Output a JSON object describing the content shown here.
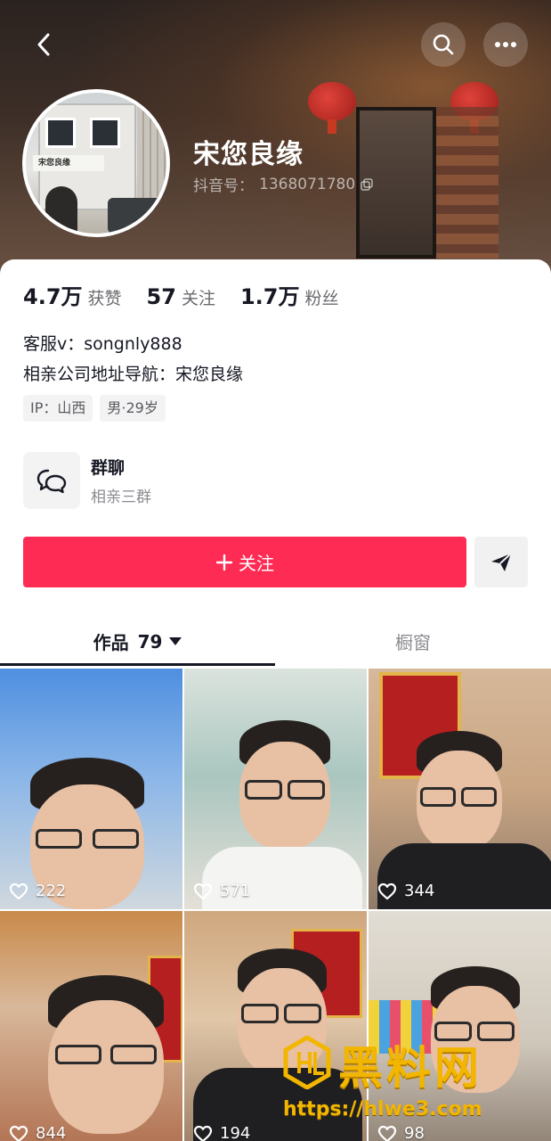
{
  "profile": {
    "display_name": "宋您良缘",
    "douyin_id_label": "抖音号：",
    "douyin_id": "1368071780",
    "avatar_sign_text": "宋您良缘"
  },
  "stats": [
    {
      "value": "4.7万",
      "label": "获赞"
    },
    {
      "value": "57",
      "label": "关注"
    },
    {
      "value": "1.7万",
      "label": "粉丝"
    }
  ],
  "bio": {
    "line1": "客服v：songnly888",
    "line2": "相亲公司地址导航：宋您良缘"
  },
  "tags": [
    "IP：山西",
    "男·29岁"
  ],
  "group_chat": {
    "title": "群聊",
    "subtitle": "相亲三群"
  },
  "actions": {
    "follow_label": "关注"
  },
  "tabs": {
    "works_label": "作品",
    "works_count": "79",
    "shop_label": "橱窗"
  },
  "videos": [
    {
      "likes": "222",
      "bg": "#6f9fd8"
    },
    {
      "likes": "571",
      "bg": "#cfd8d2"
    },
    {
      "likes": "344",
      "bg": "#c9b59a"
    },
    {
      "likes": "844",
      "bg": "#b98a6a"
    },
    {
      "likes": "194",
      "bg": "#c4a07c"
    },
    {
      "likes": "98",
      "bg": "#d4cbbf"
    }
  ],
  "watermark": {
    "title": "黑料网",
    "url": "https://hlwe3.com"
  },
  "colors": {
    "follow_button": "#fe2c55",
    "watermark": "#f2b600"
  }
}
